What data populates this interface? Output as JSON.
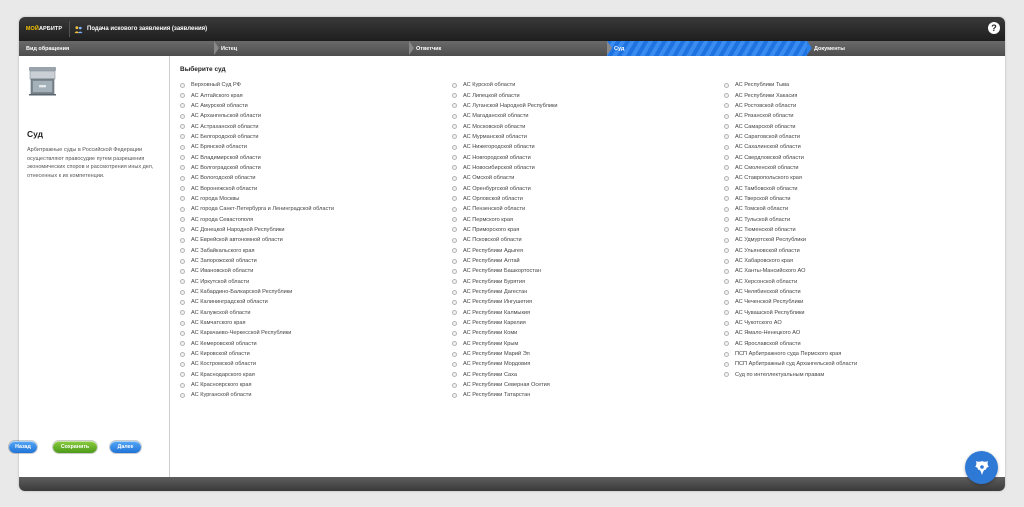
{
  "header": {
    "logo": {
      "accent": "МОЙ",
      "rest": "АРБИТР"
    },
    "title": "Подача искового заявления (заявления)",
    "help_label": "?"
  },
  "steps": [
    {
      "label": "Вид обращения",
      "active": false
    },
    {
      "label": "Истец",
      "active": false
    },
    {
      "label": "Ответчик",
      "active": false
    },
    {
      "label": "Суд",
      "active": true
    },
    {
      "label": "Документы",
      "active": false
    }
  ],
  "sidebar": {
    "title": "Суд",
    "description": "Арбитражные суды в Российской Федерации осуществляют правосудие путем разрешения экономических споров и рассмотрения иных дел, отнесенных к их компетенции.",
    "buttons": {
      "back": "Назад",
      "save": "Сохранить",
      "next": "Далее"
    }
  },
  "main": {
    "title": "Выберите суд",
    "columns": [
      [
        "Верховный Суд РФ",
        "АС Алтайского края",
        "АС Амурской области",
        "АС Архангельской области",
        "АС Астраханской области",
        "АС Белгородской области",
        "АС Брянской области",
        "АС Владимирской области",
        "АС Волгоградской области",
        "АС Вологодской области",
        "АС Воронежской области",
        "АС города Москвы",
        "АС города Санкт-Петербурга и Ленинградской области",
        "АС города Севастополя",
        "АС Донецкой Народной Республики",
        "АС Еврейской автономной области",
        "АС Забайкальского края",
        "АС Запорожской области",
        "АС Ивановской области",
        "АС Иркутской области",
        "АС Кабардино-Балкарской Республики",
        "АС Калининградской области",
        "АС Калужской области",
        "АС Камчатского края",
        "АС Карачаево-Черкесской Республики",
        "АС Кемеровской области",
        "АС Кировской области",
        "АС Костромской области",
        "АС Краснодарского края",
        "АС Красноярского края",
        "АС Курганской области"
      ],
      [
        "АС Курской области",
        "АС Липецкой области",
        "АС Луганской Народной Республики",
        "АС Магаданской области",
        "АС Московской области",
        "АС Мурманской области",
        "АС Нижегородской области",
        "АС Новгородской области",
        "АС Новосибирской области",
        "АС Омской области",
        "АС Оренбургской области",
        "АС Орловской области",
        "АС Пензенской области",
        "АС Пермского края",
        "АС Приморского края",
        "АС Псковской области",
        "АС Республики Адыгея",
        "АС Республики Алтай",
        "АС Республики Башкортостан",
        "АС Республики Бурятия",
        "АС Республики Дагестан",
        "АС Республики Ингушетия",
        "АС Республики Калмыкия",
        "АС Республики Карелия",
        "АС Республики Коми",
        "АС Республики Крым",
        "АС Республики Марий Эл",
        "АС Республики Мордовия",
        "АС Республики Саха",
        "АС Республики Северная Осетия",
        "АС Республики Татарстан"
      ],
      [
        "АС Республики Тыва",
        "АС Республики Хакасия",
        "АС Ростовской области",
        "АС Рязанской области",
        "АС Самарской области",
        "АС Саратовской области",
        "АС Сахалинской области",
        "АС Свердловской области",
        "АС Смоленской области",
        "АС Ставропольского края",
        "АС Тамбовской области",
        "АС Тверской области",
        "АС Томской области",
        "АС Тульской области",
        "АС Тюменской области",
        "АС Удмуртской Республики",
        "АС Ульяновской области",
        "АС Хабаровского края",
        "АС Ханты-Мансийского АО",
        "АС Херсонской области",
        "АС Челябинской области",
        "АС Чеченской Республики",
        "АС Чувашской Республики",
        "АС Чукотского АО",
        "АС Ямало-Ненецкого АО",
        "АС Ярославской области",
        "ПСП Арбитражного суда Пермского края",
        "ПСП Арбитражный суд Архангельской области",
        "Суд по интеллектуальным правам"
      ]
    ]
  },
  "fab_icon": "emblem-icon",
  "colors": {
    "accent": "#2a7fe8",
    "save": "#5fae24",
    "logo_accent": "#f7c300"
  }
}
